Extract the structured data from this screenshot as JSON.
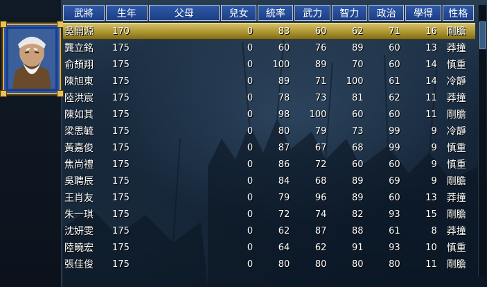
{
  "table": {
    "headers": [
      "武將",
      "生年",
      "父母",
      "兒女",
      "統率",
      "武力",
      "智力",
      "政治",
      "學得",
      "性格"
    ],
    "selected_index": 0,
    "rows": [
      {
        "name": "吳開源",
        "born": "170",
        "parent": "",
        "children": "0",
        "lead": "83",
        "war": "60",
        "int": "62",
        "pol": "71",
        "learned": "16",
        "personality": "剛膽"
      },
      {
        "name": "龔立銘",
        "born": "175",
        "parent": "",
        "children": "0",
        "lead": "60",
        "war": "76",
        "int": "89",
        "pol": "60",
        "learned": "13",
        "personality": "莽撞"
      },
      {
        "name": "俞頡翔",
        "born": "175",
        "parent": "",
        "children": "0",
        "lead": "100",
        "war": "89",
        "int": "70",
        "pol": "60",
        "learned": "14",
        "personality": "慎重"
      },
      {
        "name": "陳旭東",
        "born": "175",
        "parent": "",
        "children": "0",
        "lead": "89",
        "war": "71",
        "int": "100",
        "pol": "61",
        "learned": "14",
        "personality": "冷靜"
      },
      {
        "name": "陸洪宸",
        "born": "175",
        "parent": "",
        "children": "0",
        "lead": "78",
        "war": "73",
        "int": "81",
        "pol": "62",
        "learned": "11",
        "personality": "莽撞"
      },
      {
        "name": "陳如其",
        "born": "175",
        "parent": "",
        "children": "0",
        "lead": "98",
        "war": "100",
        "int": "60",
        "pol": "60",
        "learned": "11",
        "personality": "剛膽"
      },
      {
        "name": "梁思毓",
        "born": "175",
        "parent": "",
        "children": "0",
        "lead": "80",
        "war": "79",
        "int": "73",
        "pol": "99",
        "learned": "9",
        "personality": "冷靜"
      },
      {
        "name": "黃嘉俊",
        "born": "175",
        "parent": "",
        "children": "0",
        "lead": "87",
        "war": "67",
        "int": "68",
        "pol": "99",
        "learned": "9",
        "personality": "慎重"
      },
      {
        "name": "焦尚禮",
        "born": "175",
        "parent": "",
        "children": "0",
        "lead": "86",
        "war": "72",
        "int": "60",
        "pol": "60",
        "learned": "9",
        "personality": "慎重"
      },
      {
        "name": "吳聘辰",
        "born": "175",
        "parent": "",
        "children": "0",
        "lead": "84",
        "war": "68",
        "int": "89",
        "pol": "69",
        "learned": "9",
        "personality": "剛膽"
      },
      {
        "name": "王肖友",
        "born": "175",
        "parent": "",
        "children": "0",
        "lead": "79",
        "war": "96",
        "int": "89",
        "pol": "60",
        "learned": "13",
        "personality": "莽撞"
      },
      {
        "name": "朱一琪",
        "born": "175",
        "parent": "",
        "children": "0",
        "lead": "72",
        "war": "74",
        "int": "82",
        "pol": "93",
        "learned": "15",
        "personality": "剛膽"
      },
      {
        "name": "沈妍雯",
        "born": "175",
        "parent": "",
        "children": "0",
        "lead": "62",
        "war": "87",
        "int": "88",
        "pol": "61",
        "learned": "8",
        "personality": "莽撞"
      },
      {
        "name": "陸曉宏",
        "born": "175",
        "parent": "",
        "children": "0",
        "lead": "64",
        "war": "62",
        "int": "91",
        "pol": "93",
        "learned": "10",
        "personality": "慎重"
      },
      {
        "name": "張佳俊",
        "born": "175",
        "parent": "",
        "children": "0",
        "lead": "80",
        "war": "80",
        "int": "80",
        "pol": "80",
        "learned": "11",
        "personality": "剛膽"
      }
    ]
  },
  "portrait": {
    "icon": "elder-general-portrait-icon",
    "frame_color": "#d8b24a",
    "bg_color": "#1a3f8a"
  },
  "colors": {
    "header_bg": "#2456a0",
    "selected_row": "#b39a36",
    "text": "#ffffff"
  }
}
